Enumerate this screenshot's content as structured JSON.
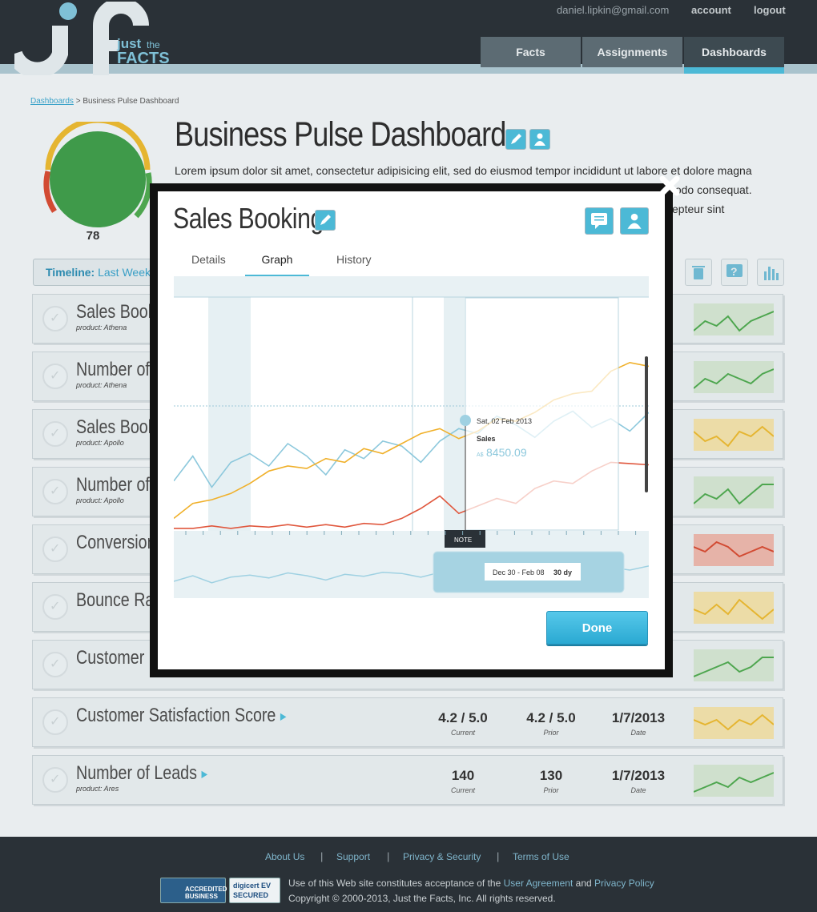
{
  "header": {
    "logo_text": "Just the FACTS",
    "user_email": "daniel.lipkin@gmail.com",
    "account_label": "account",
    "logout_label": "logout",
    "nav": [
      {
        "label": "Facts",
        "active": false
      },
      {
        "label": "Assignments",
        "active": false
      },
      {
        "label": "Dashboards",
        "active": true
      }
    ]
  },
  "breadcrumb": {
    "link": "Dashboards",
    "separator": ">",
    "current": "Business Pulse Dashboard"
  },
  "gauge": {
    "value": "78",
    "colors": {
      "fill": "#3f9a4a",
      "ring_red": "#d24b33",
      "ring_yellow": "#e5b531",
      "ring_green": "#4ea64f"
    }
  },
  "page": {
    "title": "Business Pulse Dashboard",
    "description": "Lorem ipsum dolor sit amet, consectetur adipisicing elit, sed do eiusmod tempor incididunt ut labore et dolore magna aliqua. Ut enim ad minim veniam, quis nostrud exercitation ullamco laboris nisi ut aliquip ex ea commodo consequat. Duis aute irure dolor in reprehenderit in voluptate velit esse cillum dolore eu fugiat nulla pariatur. Excepteur sint occaecat cupidatat non proident, sunt in culpa qui officia deserunt mollit anim id est laborum.",
    "edit_icon": "pencil-icon",
    "share_icon": "share-user-icon"
  },
  "timeline": {
    "label": "Timeline:",
    "value": "Last Week"
  },
  "toolbar_icons": [
    "trash-icon",
    "help-icon",
    "bar-chart-icon"
  ],
  "rows": [
    {
      "name": "Sales Bookings",
      "product": "product: Athena",
      "current": "",
      "prior": "",
      "date": "",
      "spark_color": "#4ea64f",
      "spark_bg": "#cfe0cd",
      "spark": [
        5,
        3,
        4,
        2,
        5,
        3,
        2,
        1
      ]
    },
    {
      "name": "Number of Customers",
      "product": "product: Athena",
      "current": "",
      "prior": "",
      "date": "",
      "spark_color": "#4ea64f",
      "spark_bg": "#cfe0cd",
      "spark": [
        5,
        3,
        4,
        2,
        3,
        4,
        2,
        1
      ]
    },
    {
      "name": "Sales Bookings",
      "product": "product: Apollo",
      "current": "",
      "prior": "",
      "date": "",
      "spark_color": "#e5b531",
      "spark_bg": "#ecdca7",
      "spark": [
        2,
        4,
        3,
        5,
        2,
        3,
        1,
        3
      ]
    },
    {
      "name": "Number of Customers",
      "product": "product: Apollo",
      "current": "",
      "prior": "",
      "date": "",
      "spark_color": "#4ea64f",
      "spark_bg": "#cfe0cd",
      "spark": [
        5,
        3,
        4,
        2,
        5,
        3,
        1,
        1
      ]
    },
    {
      "name": "Conversion Rate",
      "product": "",
      "current": "",
      "prior": "",
      "date": "",
      "spark_color": "#d24b33",
      "spark_bg": "#e6b3a8",
      "spark": [
        2,
        3,
        1,
        2,
        4,
        3,
        2,
        3
      ]
    },
    {
      "name": "Bounce Rate",
      "product": "",
      "current": "",
      "prior": "",
      "date": "",
      "spark_color": "#e5b531",
      "spark_bg": "#ecdca7",
      "spark": [
        3,
        4,
        2,
        4,
        1,
        3,
        5,
        3
      ]
    },
    {
      "name": "Customer Retention",
      "product": "",
      "current": "",
      "prior": "",
      "date": "",
      "spark_color": "#4ea64f",
      "spark_bg": "#cfe0cd",
      "spark": [
        5,
        4,
        3,
        2,
        4,
        3,
        1,
        1
      ]
    },
    {
      "name": "Customer Satisfaction Score",
      "product": "",
      "current": "4.2 / 5.0",
      "prior": "4.2 / 5.0",
      "date": "1/7/2013",
      "spark_color": "#e5b531",
      "spark_bg": "#ecdca7",
      "spark": [
        2,
        3,
        2,
        4,
        2,
        3,
        1,
        3
      ]
    },
    {
      "name": "Number of Leads",
      "product": "product: Ares",
      "current": "140",
      "prior": "130",
      "date": "1/7/2013",
      "spark_color": "#4ea64f",
      "spark_bg": "#cfe0cd",
      "spark": [
        5,
        4,
        3,
        4,
        2,
        3,
        2,
        1
      ]
    }
  ],
  "row_labels": {
    "current": "Current",
    "prior": "Prior",
    "date": "Date"
  },
  "modal": {
    "title": "Sales Bookings",
    "tabs": [
      {
        "label": "Details",
        "active": false
      },
      {
        "label": "Graph",
        "active": true
      },
      {
        "label": "History",
        "active": false
      }
    ],
    "tooltip": {
      "date": "Sat, 02 Feb 2013",
      "series": "Sales",
      "currency": "A$",
      "value": "8450.09"
    },
    "note_label": "NOTE",
    "range_label": "Dec 30 - Feb 08",
    "range_days": "30 dy",
    "done_label": "Done",
    "icons": [
      "comment-icon",
      "share-user-icon",
      "close-icon"
    ]
  },
  "chart_data": {
    "type": "line",
    "series": [
      {
        "color": "#8cc8dc",
        "values": [
          40,
          60,
          35,
          55,
          62,
          52,
          70,
          60,
          45,
          65,
          58,
          72,
          68,
          55,
          72,
          82,
          78,
          92,
          85,
          75,
          88,
          96,
          83,
          90,
          80,
          95
        ]
      },
      {
        "color": "#f0b02a",
        "values": [
          10,
          22,
          25,
          30,
          38,
          48,
          52,
          50,
          58,
          55,
          66,
          62,
          70,
          78,
          82,
          74,
          80,
          90,
          88,
          95,
          105,
          110,
          112,
          128,
          135,
          132
        ]
      },
      {
        "color": "#e0573d",
        "values": [
          2,
          2,
          4,
          2,
          4,
          3,
          5,
          3,
          5,
          3,
          6,
          5,
          10,
          18,
          28,
          14,
          20,
          26,
          22,
          34,
          40,
          38,
          48,
          55,
          54,
          53
        ]
      }
    ],
    "ylim": [
      0,
      140
    ]
  },
  "footer": {
    "links": [
      "About Us",
      "Support",
      "Privacy & Security",
      "Terms of Use"
    ],
    "sep": "|",
    "acceptance_pre": "Use of this Web site constitutes acceptance of the",
    "user_agreement": "User Agreement",
    "and": "and",
    "privacy_policy": "Privacy Policy",
    "copyright": "Copyright © 2000-2013, Just the Facts, Inc. All rights reserved.",
    "badge_bbb": "ACCREDITED BUSINESS",
    "badge_digicert": "digicert EV SECURED"
  }
}
